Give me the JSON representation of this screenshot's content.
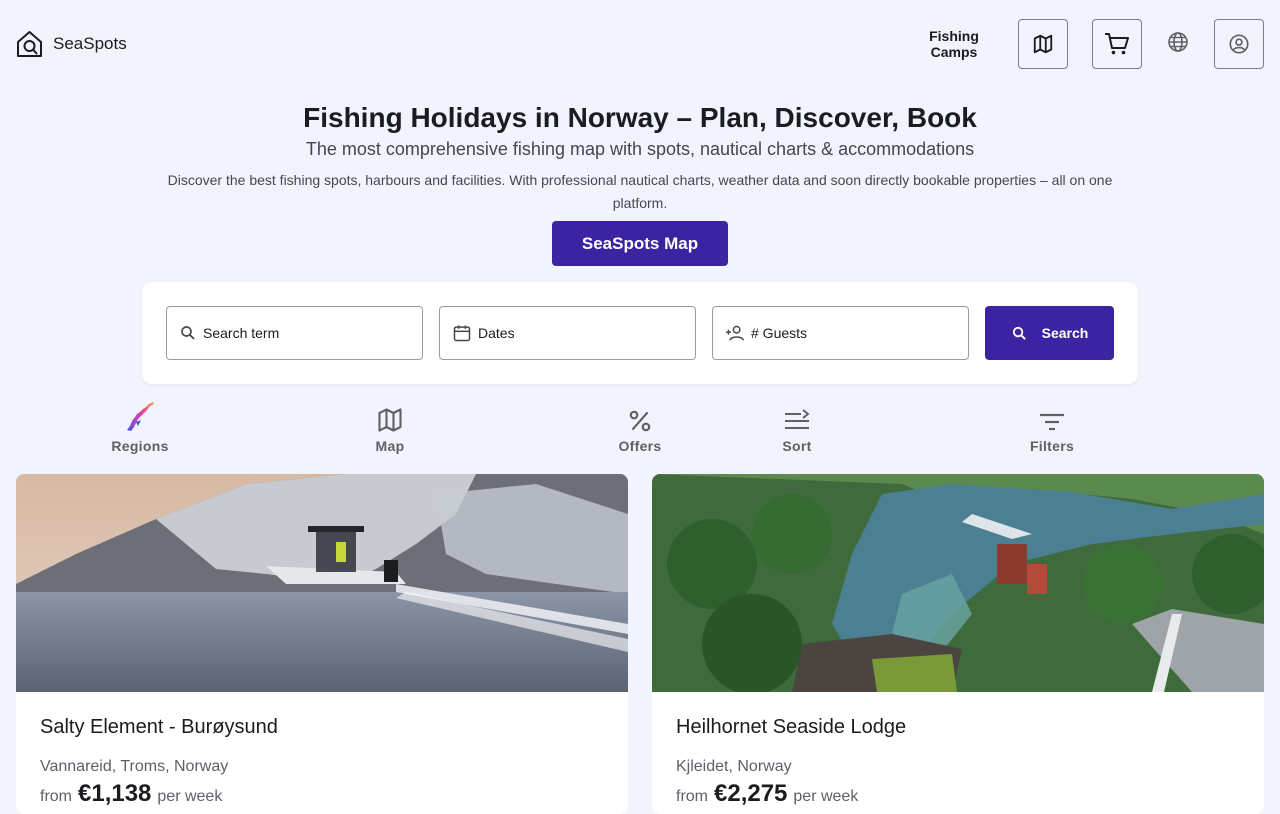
{
  "header": {
    "brand": "SeaSpots",
    "nav_label": "Fishing\nCamps",
    "icons": [
      "home-icon",
      "map-icon",
      "cart-icon",
      "globe-icon",
      "account-icon"
    ]
  },
  "hero": {
    "title": "Fishing Holidays in Norway – Plan, Discover, Book",
    "subtitle": "The most comprehensive fishing map with spots, nautical charts & accommodations",
    "description": "Discover the best fishing spots, harbours and facilities. With professional nautical charts, weather data and soon directly bookable properties – all on one platform.",
    "cta_label": "SeaSpots Map"
  },
  "search": {
    "term_placeholder": "Search term",
    "dates_placeholder": "Dates",
    "guests_placeholder": "# Guests",
    "button_label": "Search"
  },
  "toolbar": {
    "items": [
      {
        "label": "Regions",
        "icon": "norway-regions-icon"
      },
      {
        "label": "Map",
        "icon": "map-icon"
      },
      {
        "label": "Offers",
        "icon": "percent-icon"
      },
      {
        "label": "Sort",
        "icon": "sort-icon"
      },
      {
        "label": "Filters",
        "icon": "filter-icon"
      }
    ]
  },
  "listings": [
    {
      "title": "Salty Element - Burøysund",
      "location": "Vannareid, Troms, Norway",
      "from": "from",
      "price": "€1,138",
      "per": "per week"
    },
    {
      "title": "Heilhornet Seaside Lodge",
      "location": "Kjleidet, Norway",
      "from": "from",
      "price": "€2,275",
      "per": "per week"
    }
  ],
  "colors": {
    "primary": "#3b23a1",
    "background": "#f1f4fd",
    "card": "#ffffff"
  }
}
